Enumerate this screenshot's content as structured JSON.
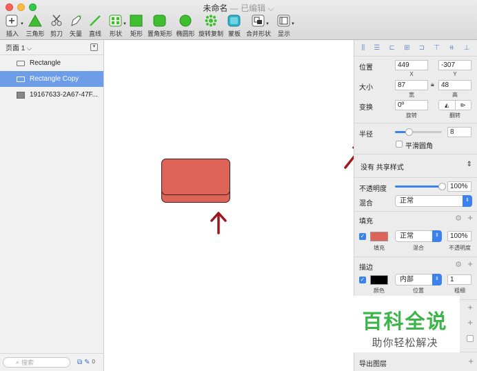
{
  "window": {
    "title": "未命名",
    "title_sep": "—",
    "title_status": "已编辑",
    "title_chevron": "⌵"
  },
  "toolbar": [
    {
      "label": "插入",
      "icon": "plus-icon"
    },
    {
      "label": "三角形",
      "icon": "triangle-icon"
    },
    {
      "label": "剪刀",
      "icon": "scissors-icon"
    },
    {
      "label": "矢量",
      "icon": "pen-icon"
    },
    {
      "label": "直线",
      "icon": "line-icon"
    },
    {
      "label": "形状",
      "icon": "shapes-icon"
    },
    {
      "label": "矩形",
      "icon": "rectangle-icon"
    },
    {
      "label": "置角矩形",
      "icon": "rounded-rectangle-icon"
    },
    {
      "label": "椭圆形",
      "icon": "oval-icon"
    },
    {
      "label": "旋转复制",
      "icon": "rotate-copy-icon"
    },
    {
      "label": "蒙板",
      "icon": "mask-icon"
    },
    {
      "label": "合并形状",
      "icon": "combine-icon"
    },
    {
      "label": "显示",
      "icon": "view-icon"
    }
  ],
  "left_panel": {
    "page_label": "页面 1",
    "page_chevron": "⌵",
    "layers": [
      {
        "name": "Rectangle",
        "selected": false,
        "icon": "rectangle-layer-icon"
      },
      {
        "name": "Rectangle Copy",
        "selected": true,
        "icon": "rectangle-layer-icon"
      },
      {
        "name": "19167633-2A67-47F...",
        "selected": false,
        "icon": "image-layer-icon"
      }
    ],
    "search_placeholder": "搜索",
    "layer_count": "0"
  },
  "inspector": {
    "position_label": "位置",
    "x_value": "449",
    "y_value": "-307",
    "x_caption": "X",
    "y_caption": "Y",
    "size_label": "大小",
    "width_value": "87",
    "height_value": "48",
    "width_caption": "宽",
    "height_caption": "高",
    "transform_label": "变换",
    "rotate_value": "0º",
    "rotate_caption": "旋转",
    "flip_caption": "翻转",
    "radius_label": "半径",
    "radius_value": "8",
    "radius_slider_fraction": 0.3,
    "smooth_corners_label": "平滑圆角",
    "shared_style": "没有 共享样式",
    "opacity_label": "不透明度",
    "opacity_value": "100%",
    "opacity_fraction": 1.0,
    "blend_label": "混合",
    "blend_value": "正常",
    "fill_header": "填充",
    "fill_color": "#de645a",
    "fill_blend": "正常",
    "fill_opacity": "100%",
    "fill_caption_color": "填充",
    "fill_caption_blend": "混合",
    "fill_caption_opacity": "不透明度",
    "border_header": "描边",
    "border_color": "#000000",
    "border_position": "内部",
    "border_width": "1",
    "border_caption_color": "颜色",
    "border_caption_position": "位置",
    "border_caption_width": "粗细",
    "export_label": "导出图层"
  },
  "watermark": {
    "title": "百科全说",
    "subtitle": "助你轻松解决"
  },
  "colors": {
    "accent": "#3b82f0",
    "selection": "#6e9de8",
    "shape_fill": "#de645a",
    "arrow": "#a0141c",
    "watermark_green": "#3bb54a"
  }
}
